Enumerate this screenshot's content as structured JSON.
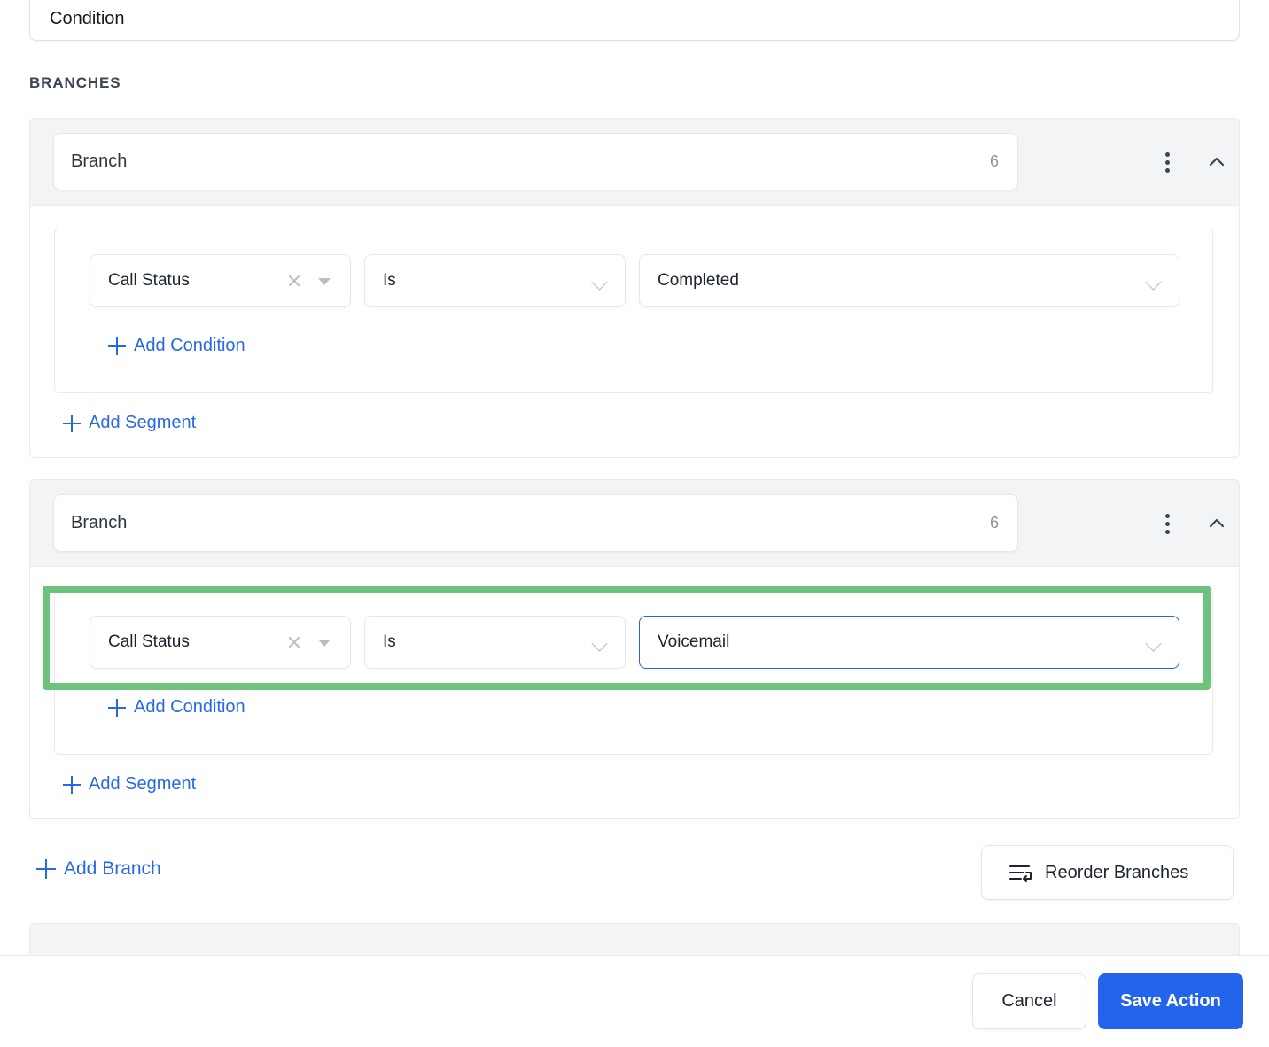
{
  "condition_field": {
    "name": "Condition",
    "value": "Condition"
  },
  "section": {
    "branches_label": "BRANCHES"
  },
  "branches": [
    {
      "name_value": "Branch",
      "char_count": "6",
      "kebab_icon": "kebab-menu-icon",
      "collapse_icon": "chevron-up-icon",
      "condition": {
        "attribute": "Call Status",
        "operator": "Is",
        "value": "Completed",
        "clear_icon": "clear-x-icon",
        "attribute_caret_icon": "caret-down-icon",
        "operator_caret_icon": "chevron-down-icon",
        "value_caret_icon": "chevron-down-icon",
        "value_focused": false
      },
      "add_condition_label": "Add Condition",
      "add_segment_label": "Add Segment"
    },
    {
      "name_value": "Branch",
      "char_count": "6",
      "kebab_icon": "kebab-menu-icon",
      "collapse_icon": "chevron-up-icon",
      "condition": {
        "attribute": "Call Status",
        "operator": "Is",
        "value": "Voicemail",
        "clear_icon": "clear-x-icon",
        "attribute_caret_icon": "caret-down-icon",
        "operator_caret_icon": "chevron-down-icon",
        "value_caret_icon": "chevron-down-icon",
        "value_focused": true
      },
      "add_condition_label": "Add Condition",
      "add_segment_label": "Add Segment"
    }
  ],
  "add_branch_label": "Add Branch",
  "reorder": {
    "label": "Reorder Branches",
    "icon": "reorder-lines-arrow-icon"
  },
  "footer": {
    "cancel_label": "Cancel",
    "save_label": "Save Action"
  },
  "annotation": {
    "color": "#6ec27c"
  },
  "colors": {
    "accent_blue": "#2463eb",
    "link_blue": "#2668e8",
    "header_gray": "#f2f4f6",
    "highlight_green": "#6ec27c"
  }
}
